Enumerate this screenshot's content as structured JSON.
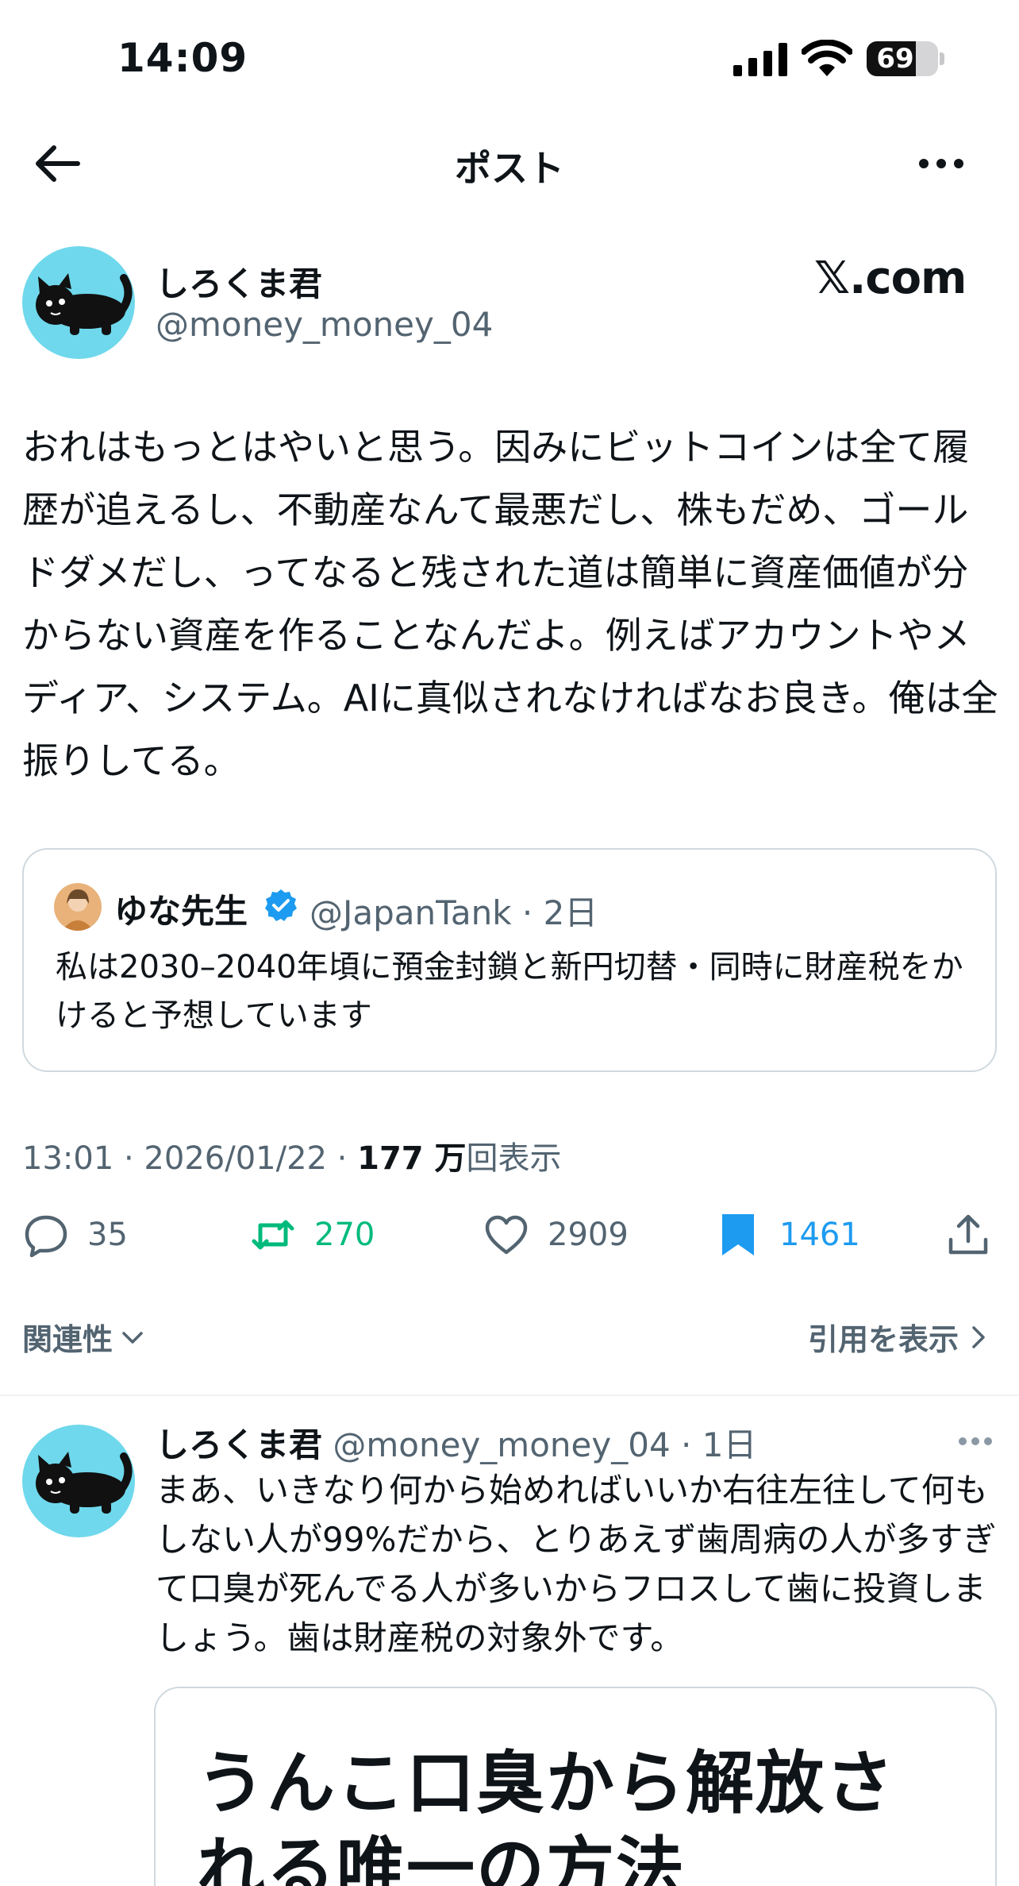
{
  "status_bar": {
    "time": "14:09",
    "battery": "69",
    "battery_level": 0.69
  },
  "header": {
    "title": "ポスト",
    "back_icon": "arrow-left-icon",
    "more_icon": "ellipsis-icon"
  },
  "post": {
    "author_name": "しろくま君",
    "author_handle": "@money_money_04",
    "source_logo": "𝕏.com",
    "text": "おれはもっとはやいと思う。因みにビットコインは全て履歴が追えるし、不動産なんて最悪だし、株もだめ、ゴールドダメだし、ってなると残された道は簡単に資産価値が分からない資産を作ることなんだよ。例えばアカウントやメディア、システム。AIに真似されなければなお良き。俺は全振りしてる。",
    "quote": {
      "name": "ゆな先生",
      "handle": "@JapanTank · 2日",
      "text": "私は2030–2040年頃に預金封鎖と新円切替・同時に財産税をかけると予想しています"
    },
    "meta": {
      "time_date": "13:01 · 2026/01/22 · ",
      "views_count": "177 万",
      "views_label": "回表示"
    },
    "actions": {
      "replies": "35",
      "reposts": "270",
      "likes": "2909",
      "bookmarks": "1461"
    }
  },
  "sort": {
    "relevance_label": "関連性",
    "quotes_label": "引用を表示"
  },
  "reply": {
    "author_name": "しろくま君",
    "meta": "@money_money_04 · 1日",
    "text": "まあ、いきなり何から始めればいいか右往左往して何もしない人が99%だから、とりあえず歯周病の人が多すぎて口臭が死んでる人が多いからフロスして歯に投資しましょう。歯は財産税の対象外です。",
    "card_title": "うんこ口臭から解放される唯一の方法"
  },
  "colors": {
    "accent": "#1d9bf0",
    "repost": "#00ba7c",
    "muted": "#536471",
    "border": "#cfd9de",
    "avatar_bg": "#6fd8ec"
  }
}
